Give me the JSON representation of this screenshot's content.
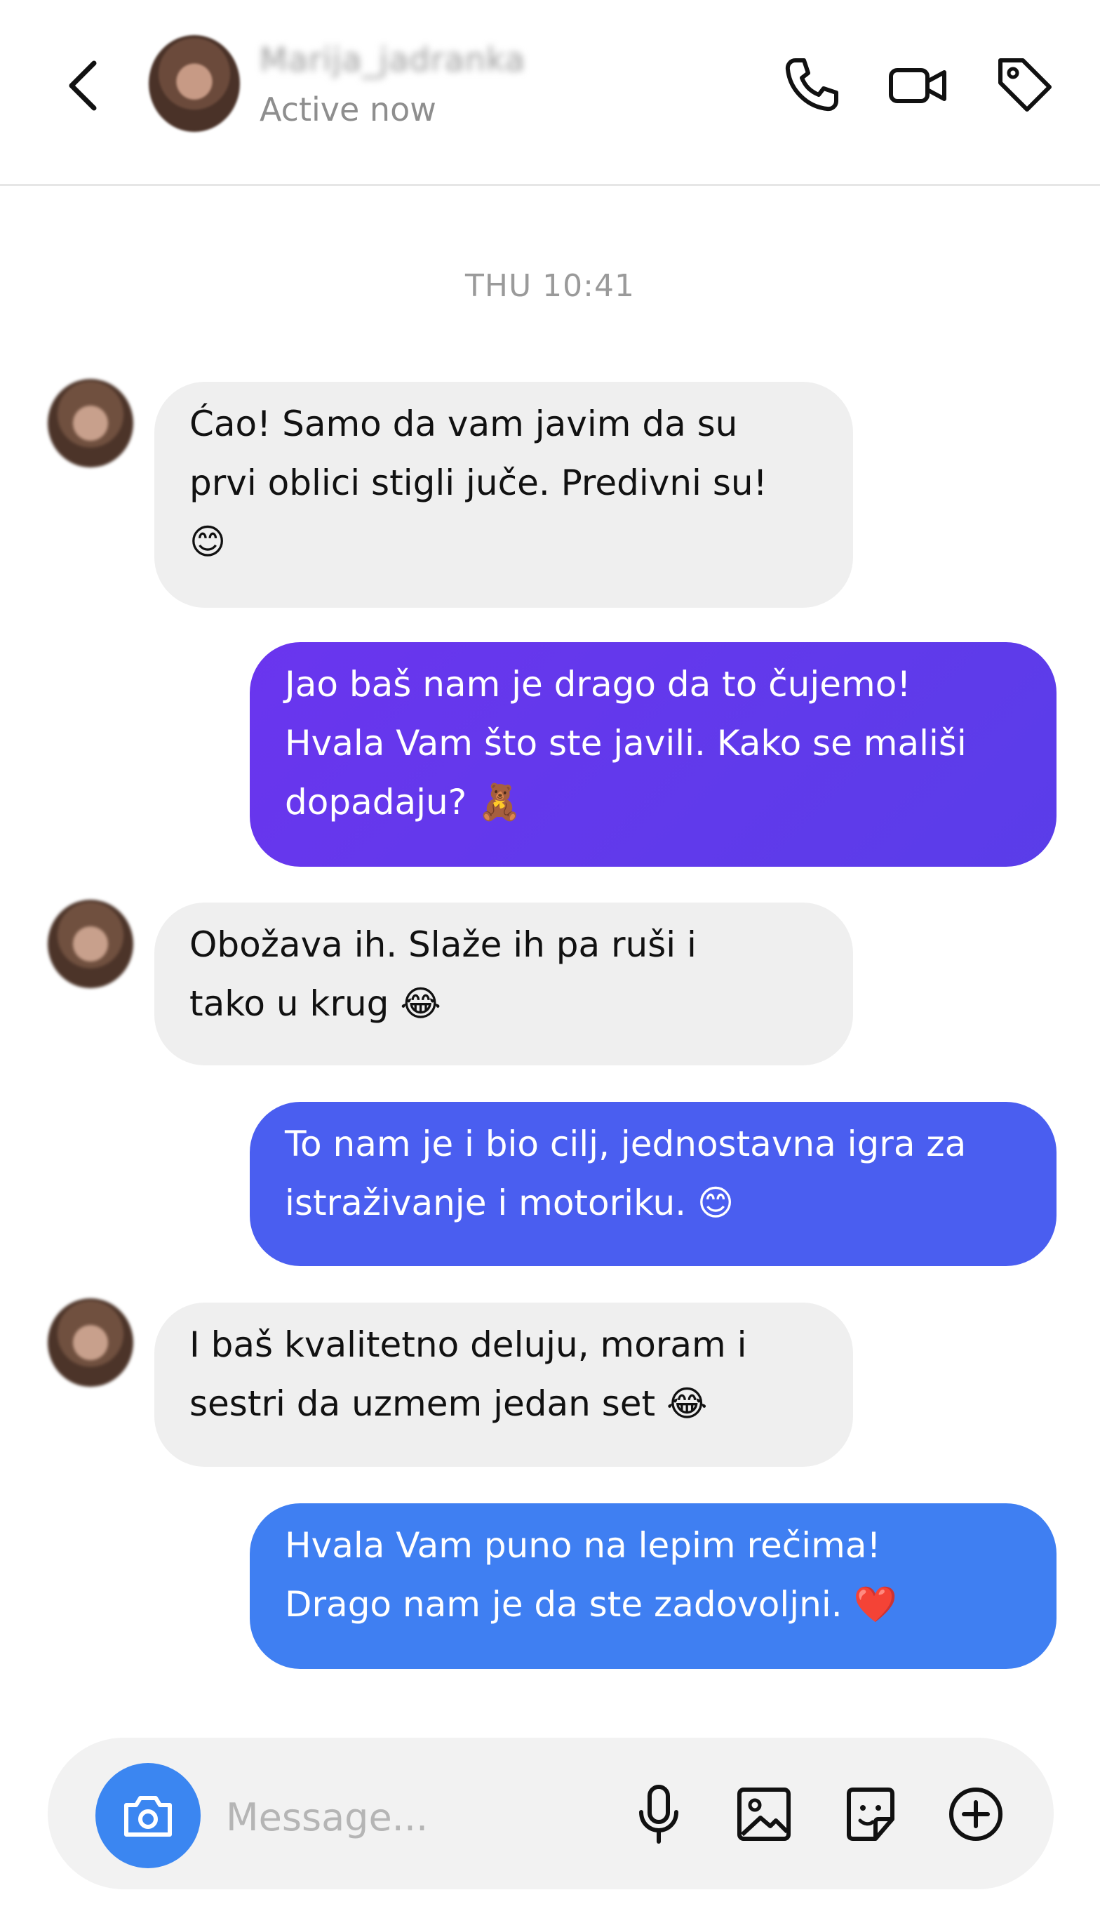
{
  "header": {
    "username": "Marija_jadranka",
    "status": "Active now",
    "icons": {
      "back": "back-arrow-icon",
      "call": "phone-icon",
      "video": "video-camera-icon",
      "tag": "tag-icon"
    }
  },
  "thread": {
    "timestamp": "THU 10:41",
    "messages": [
      {
        "from": "them",
        "text": "Ćao! Samo da vam javim da su\nprvi oblici stigli juče. Predivni su!\n😊"
      },
      {
        "from": "me",
        "text": "Jao baš nam je drago da to čujemo!\nHvala Vam što ste javili. Kako se mališi\ndopadaju? 🧸"
      },
      {
        "from": "them",
        "text": "Obožava ih. Slaže ih pa ruši i\ntako u krug 😂"
      },
      {
        "from": "me",
        "text": "To nam je i bio cilj, jednostavna igra za\nistraživanje i motoriku. 😊"
      },
      {
        "from": "them",
        "text": "I baš kvalitetno deluju, moram i\nsestri da uzmem jedan set 😂"
      },
      {
        "from": "me",
        "text": "Hvala Vam puno na lepim rečima!\nDrago nam je da ste zadovoljni. ❤️"
      }
    ]
  },
  "composer": {
    "placeholder": "Message...",
    "value": "",
    "icons": [
      "camera-icon",
      "microphone-icon",
      "image-icon",
      "sticker-icon",
      "plus-icon"
    ]
  },
  "colors": {
    "incoming_bubble": "#efefef",
    "outgoing_1": "#6a35ee",
    "outgoing_2": "#4a5ef0",
    "outgoing_3": "#3f7ff2",
    "camera_button": "#3b86f1"
  }
}
